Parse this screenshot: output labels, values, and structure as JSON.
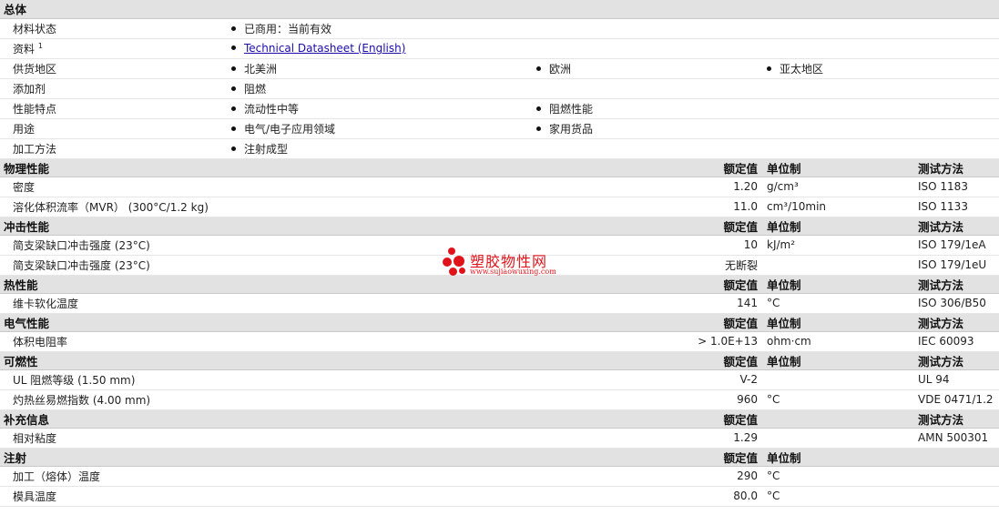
{
  "general": {
    "header": "总体",
    "rows": [
      {
        "label": "材料状态",
        "items": [
          "已商用：当前有效",
          "",
          ""
        ]
      },
      {
        "label": "资料",
        "sup": "1",
        "items": [
          "Technical Datasheet (English)",
          "",
          ""
        ],
        "link": true
      },
      {
        "label": "供货地区",
        "items": [
          "北美洲",
          "欧洲",
          "亚太地区"
        ]
      },
      {
        "label": "添加剂",
        "items": [
          "阻燃",
          "",
          ""
        ]
      },
      {
        "label": "性能特点",
        "items": [
          "流动性中等",
          "阻燃性能",
          ""
        ]
      },
      {
        "label": "用途",
        "items": [
          "电气/电子应用领域",
          "家用货品",
          ""
        ]
      },
      {
        "label": "加工方法",
        "items": [
          "注射成型",
          "",
          ""
        ]
      }
    ]
  },
  "col_headers": {
    "nominal": "额定值",
    "unit": "单位制",
    "method": "测试方法"
  },
  "sections": [
    {
      "title": "物理性能",
      "show_unit": true,
      "show_method": true,
      "rows": [
        {
          "name": "密度",
          "value": "1.20",
          "unit": "g/cm³",
          "method": "ISO 1183"
        },
        {
          "name": "溶化体积流率（MVR） (300°C/1.2 kg)",
          "value": "11.0",
          "unit": "cm³/10min",
          "method": "ISO 1133"
        }
      ]
    },
    {
      "title": "冲击性能",
      "show_unit": true,
      "show_method": true,
      "rows": [
        {
          "name": "简支梁缺口冲击强度 (23°C)",
          "value": "10",
          "unit": "kJ/m²",
          "method": "ISO 179/1eA"
        },
        {
          "name": "简支梁缺口冲击强度 (23°C)",
          "value": "无断裂",
          "unit": "",
          "method": "ISO 179/1eU"
        }
      ]
    },
    {
      "title": "热性能",
      "show_unit": true,
      "show_method": true,
      "rows": [
        {
          "name": "维卡软化温度",
          "value": "141",
          "unit": "°C",
          "method": "ISO 306/B50"
        }
      ]
    },
    {
      "title": "电气性能",
      "show_unit": true,
      "show_method": true,
      "rows": [
        {
          "name": "体积电阻率",
          "value": "> 1.0E+13",
          "unit": "ohm·cm",
          "method": "IEC 60093"
        }
      ]
    },
    {
      "title": "可燃性",
      "show_unit": true,
      "show_method": true,
      "rows": [
        {
          "name": "UL 阻燃等级 (1.50 mm)",
          "value": "V-2",
          "unit": "",
          "method": "UL 94"
        },
        {
          "name": "灼热丝易燃指数 (4.00 mm)",
          "value": "960",
          "unit": "°C",
          "method": "VDE 0471/1.2"
        }
      ]
    },
    {
      "title": "补充信息",
      "show_unit": false,
      "show_method": true,
      "rows": [
        {
          "name": "相对粘度",
          "value": "1.29",
          "unit": "",
          "method": "AMN 500301"
        }
      ]
    },
    {
      "title": "注射",
      "show_unit": true,
      "show_method": false,
      "rows": [
        {
          "name": "加工（熔体）温度",
          "value": "290",
          "unit": "°C",
          "method": ""
        },
        {
          "name": "模具温度",
          "value": "80.0",
          "unit": "°C",
          "method": ""
        }
      ]
    }
  ],
  "watermark": {
    "title": "塑胶物性网",
    "url": "www.sujiaowuxing.com"
  }
}
